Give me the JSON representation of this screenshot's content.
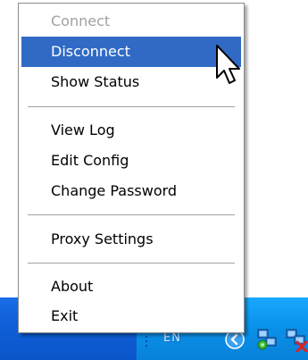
{
  "menu": {
    "items": [
      {
        "label": "Connect",
        "state": "disabled"
      },
      {
        "label": "Disconnect",
        "state": "highlighted"
      },
      {
        "label": "Show Status",
        "state": "normal"
      },
      {
        "label": "View Log",
        "state": "normal"
      },
      {
        "label": "Edit Config",
        "state": "normal"
      },
      {
        "label": "Change Password",
        "state": "normal"
      },
      {
        "label": "Proxy Settings",
        "state": "normal"
      },
      {
        "label": "About",
        "state": "normal"
      },
      {
        "label": "Exit",
        "state": "normal"
      }
    ]
  },
  "taskbar": {
    "tray_text": "EN",
    "icons": [
      "show-hidden-icons-icon",
      "network-connected-icon",
      "network-disconnected-icon"
    ]
  },
  "colors": {
    "highlight": "#316ac5",
    "disabled_text": "#a1a1a1",
    "taskbar": "#0f5fd8",
    "tray": "#0a90e8"
  }
}
